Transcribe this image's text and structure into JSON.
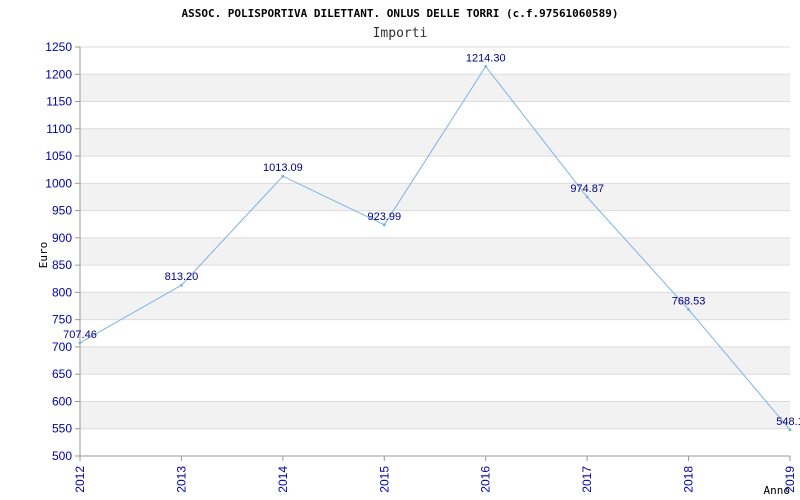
{
  "chart_data": {
    "type": "line",
    "title": "ASSOC. POLISPORTIVA DILETTANT. ONLUS DELLE TORRI (c.f.97561060589)",
    "subtitle": "Importi",
    "xlabel": "Anno",
    "ylabel": "Euro",
    "x": [
      "2012",
      "2013",
      "2014",
      "2015",
      "2016",
      "2017",
      "2018",
      "2019"
    ],
    "series": [
      {
        "values": [
          707.46,
          813.2,
          1013.09,
          923.99,
          1214.3,
          974.87,
          768.53,
          548.1
        ]
      }
    ],
    "data_labels": [
      "707.46",
      "813.20",
      "1013.09",
      "923.99",
      "1214.30",
      "974.87",
      "768.53",
      "548.1"
    ],
    "ylim": [
      500,
      1250
    ],
    "yticks": [
      500,
      550,
      600,
      650,
      700,
      750,
      800,
      850,
      900,
      950,
      1000,
      1050,
      1100,
      1150,
      1200,
      1250
    ],
    "grid": true,
    "line_color": "#7fb2e5",
    "band_color": "#f2f2f2"
  }
}
